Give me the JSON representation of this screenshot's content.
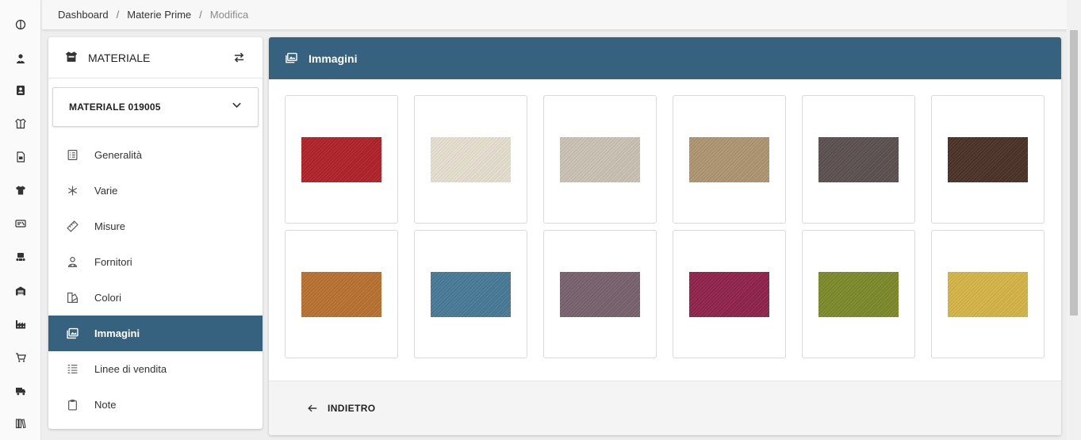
{
  "breadcrumb": [
    {
      "label": "Dashboard",
      "current": false
    },
    {
      "label": "Materie Prime",
      "current": false
    },
    {
      "label": "Modifica",
      "current": true
    }
  ],
  "rail": {
    "icons": [
      "globe-icon",
      "user-tie-icon",
      "address-book-icon",
      "box-open-icon",
      "file-invoice-icon",
      "tshirt-icon",
      "tag-ticket-icon",
      "people-carry-icon",
      "warehouse-icon",
      "industry-icon",
      "cart-icon",
      "truck-icon",
      "books-icon"
    ]
  },
  "sidebar": {
    "title": "MATERIALE",
    "title_icon": "box-open-icon",
    "swap_icon": "swap-arrows-icon",
    "selected_material": "MATERIALE 019005",
    "items": [
      {
        "label": "Generalità",
        "icon": "list-icon",
        "active": false
      },
      {
        "label": "Varie",
        "icon": "asterisk-icon",
        "active": false
      },
      {
        "label": "Misure",
        "icon": "ruler-icon",
        "active": false
      },
      {
        "label": "Fornitori",
        "icon": "supplier-icon",
        "active": false
      },
      {
        "label": "Colori",
        "icon": "palette-icon",
        "active": false
      },
      {
        "label": "Immagini",
        "icon": "images-icon",
        "active": true
      },
      {
        "label": "Linee di vendita",
        "icon": "lines-icon",
        "active": false
      },
      {
        "label": "Note",
        "icon": "clipboard-icon",
        "active": false
      }
    ]
  },
  "main": {
    "title": "Immagini",
    "title_icon": "images-icon",
    "swatch_colors": [
      "#b5232b",
      "#ebe4d4",
      "#cfc6b8",
      "#b39873",
      "#5e5352",
      "#4d3329",
      "#bd7431",
      "#4a7d9b",
      "#7c6470",
      "#93244d",
      "#7f8d2b",
      "#d9b849"
    ],
    "back_label": "INDIETRO"
  }
}
